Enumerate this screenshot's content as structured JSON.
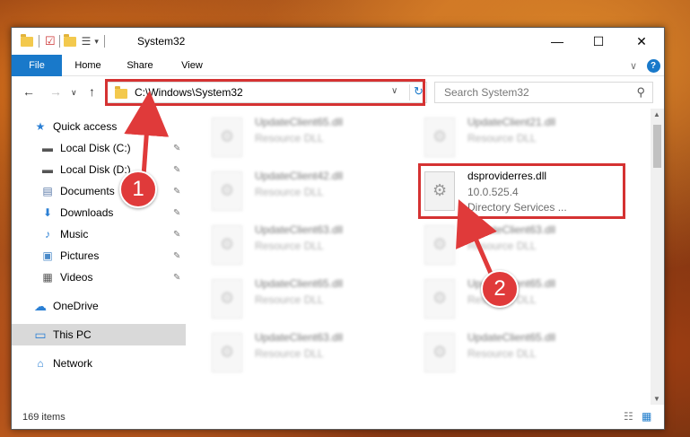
{
  "window": {
    "title": "System32"
  },
  "title_buttons": {
    "minimize": "—",
    "maximize": "☐",
    "close": "✕"
  },
  "ribbon": {
    "tabs": [
      "File",
      "Home",
      "Share",
      "View"
    ],
    "expand": "∨",
    "help": "?"
  },
  "navigation": {
    "back": "←",
    "forward": "→",
    "recent": "∨",
    "up": "↑"
  },
  "address": {
    "path": "C:\\Windows\\System32",
    "dropdown": "∨",
    "refresh": "↻"
  },
  "search": {
    "placeholder": "Search System32",
    "icon": "⚲"
  },
  "sidebar": {
    "items": [
      {
        "label": "Quick access",
        "icon": "star-icon",
        "glyph": "★"
      },
      {
        "label": "Local Disk (C:)",
        "icon": "disk-icon",
        "glyph": "▬"
      },
      {
        "label": "Local Disk (D:)",
        "icon": "disk-icon",
        "glyph": "▬"
      },
      {
        "label": "Documents",
        "icon": "documents-icon",
        "glyph": "▤"
      },
      {
        "label": "Downloads",
        "icon": "download-icon",
        "glyph": "⬇"
      },
      {
        "label": "Music",
        "icon": "music-icon",
        "glyph": "♪"
      },
      {
        "label": "Pictures",
        "icon": "pictures-icon",
        "glyph": "▣"
      },
      {
        "label": "Videos",
        "icon": "videos-icon",
        "glyph": "▦"
      },
      {
        "label": "OneDrive",
        "icon": "cloud-icon",
        "glyph": "☁"
      },
      {
        "label": "This PC",
        "icon": "computer-icon",
        "glyph": "▭"
      },
      {
        "label": "Network",
        "icon": "network-icon",
        "glyph": "⌂"
      }
    ],
    "pin_glyph": "📌"
  },
  "files": [
    {
      "name": "UpdateClient65.dll",
      "line2": "Resource DLL"
    },
    {
      "name": "UpdateClient21.dll",
      "line2": "Resource DLL"
    },
    {
      "name": "UpdateClient42.dll",
      "line2": "Resource DLL"
    },
    {
      "name": "dsproviderres.dll",
      "line2": "10.0.525.4",
      "line3": "Directory Services ..."
    },
    {
      "name": "UpdateClient63.dll",
      "line2": "Resource DLL"
    },
    {
      "name": "UpdateClient63.dll",
      "line2": "Resource DLL"
    },
    {
      "name": "UpdateClient65.dll",
      "line2": "Resource DLL"
    },
    {
      "name": "UpdateClient65.dll",
      "line2": "Resource DLL"
    },
    {
      "name": "UpdateClient63.dll",
      "line2": "Resource DLL"
    },
    {
      "name": "UpdateClient65.dll",
      "line2": "Resource DLL"
    }
  ],
  "status": {
    "count": "169 items"
  },
  "annotations": {
    "badge1": "1",
    "badge2": "2"
  },
  "colors": {
    "accent": "#1979ca",
    "highlight": "#d53232",
    "badge": "#e03a3a"
  }
}
